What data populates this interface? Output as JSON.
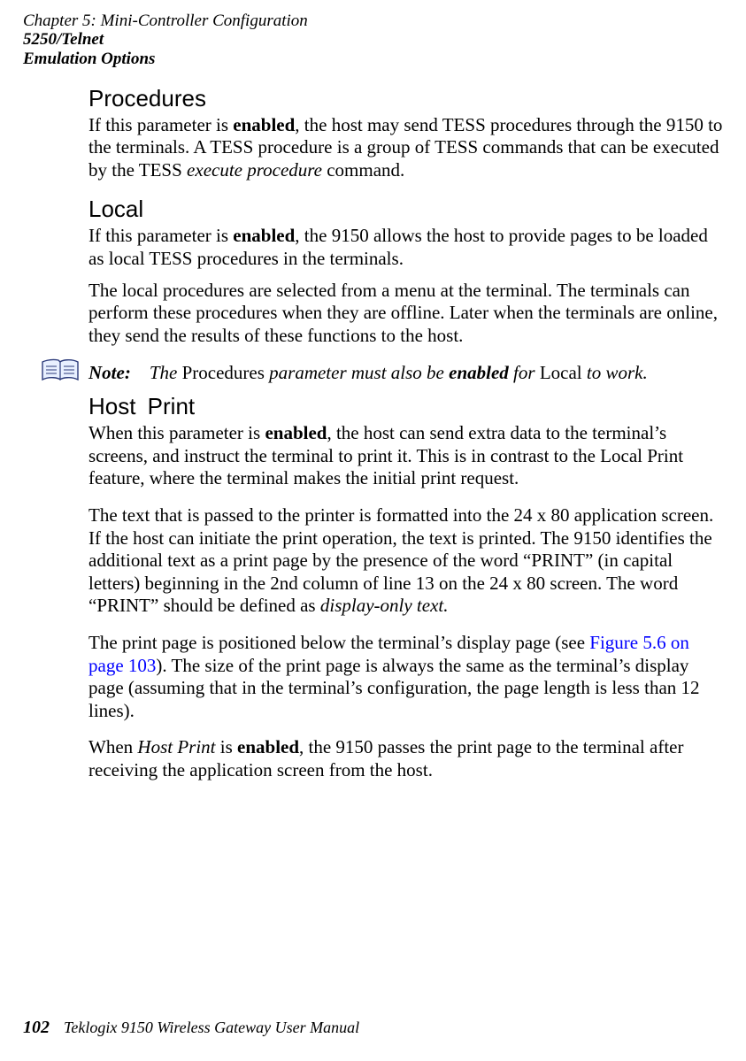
{
  "header": {
    "chapter": "Chapter 5:  Mini-Controller Configuration",
    "section_line1": "5250/Telnet",
    "section_line2": "Emulation Options"
  },
  "sections": {
    "procedures": {
      "heading": "Procedures",
      "p1_a": "If this parameter is ",
      "p1_b": "enabled",
      "p1_c": ", the host may send TESS procedures through the 9150 to the terminals. A TESS procedure is a group of TESS commands that can be executed by the TESS ",
      "p1_d": "execute procedure",
      "p1_e": " command."
    },
    "local": {
      "heading": "Local",
      "p1_a": "If this parameter is ",
      "p1_b": "enabled",
      "p1_c": ", the 9150 allows the host to provide pages to be loaded as local TESS procedures in the terminals.",
      "p2": "The local procedures are selected from a menu at the terminal. The terminals can perform these procedures when they are offline. Later when the terminals are online, they send the results of these functions to the host."
    },
    "note": {
      "label": "Note:",
      "a": "The ",
      "b": "Procedures",
      "c": " parameter must also be ",
      "d": "enabled",
      "e": " for ",
      "f": "Local",
      "g": " to work."
    },
    "hostprint": {
      "heading": "Host Print",
      "p1_a": "When this parameter is ",
      "p1_b": "enabled",
      "p1_c": ", the host can send extra data to the terminal’s screens, and instruct the terminal to print it. This is in contrast to the Local Print feature, where the terminal makes the initial print request.",
      "p2": "The text that is passed to the printer is formatted into the 24 x 80 application screen. If the host can initiate the print operation, the text is printed. The 9150 identifies the additional text as a print page by the presence of the word “PRINT” (in capital letters) beginning in the 2nd column of line 13 on the 24 x 80 screen. The word “PRINT” should be defined as ",
      "p2_i": "display-only text.",
      "p3_a": "The print page is positioned below the terminal’s display page (see ",
      "p3_link": "Figure 5.6 on page 103",
      "p3_b": "). The size of the print page is always the same as the terminal’s display page (assuming that in the terminal’s configuration, the page length is less than 12 lines).",
      "p4_a": "When ",
      "p4_b": "Host Print",
      "p4_c": " is ",
      "p4_d": "enabled",
      "p4_e": ", the 9150 passes the print page to the terminal after receiving the application screen from the host."
    }
  },
  "footer": {
    "page_number": "102",
    "manual": "Teklogix 9150 Wireless Gateway User Manual"
  }
}
